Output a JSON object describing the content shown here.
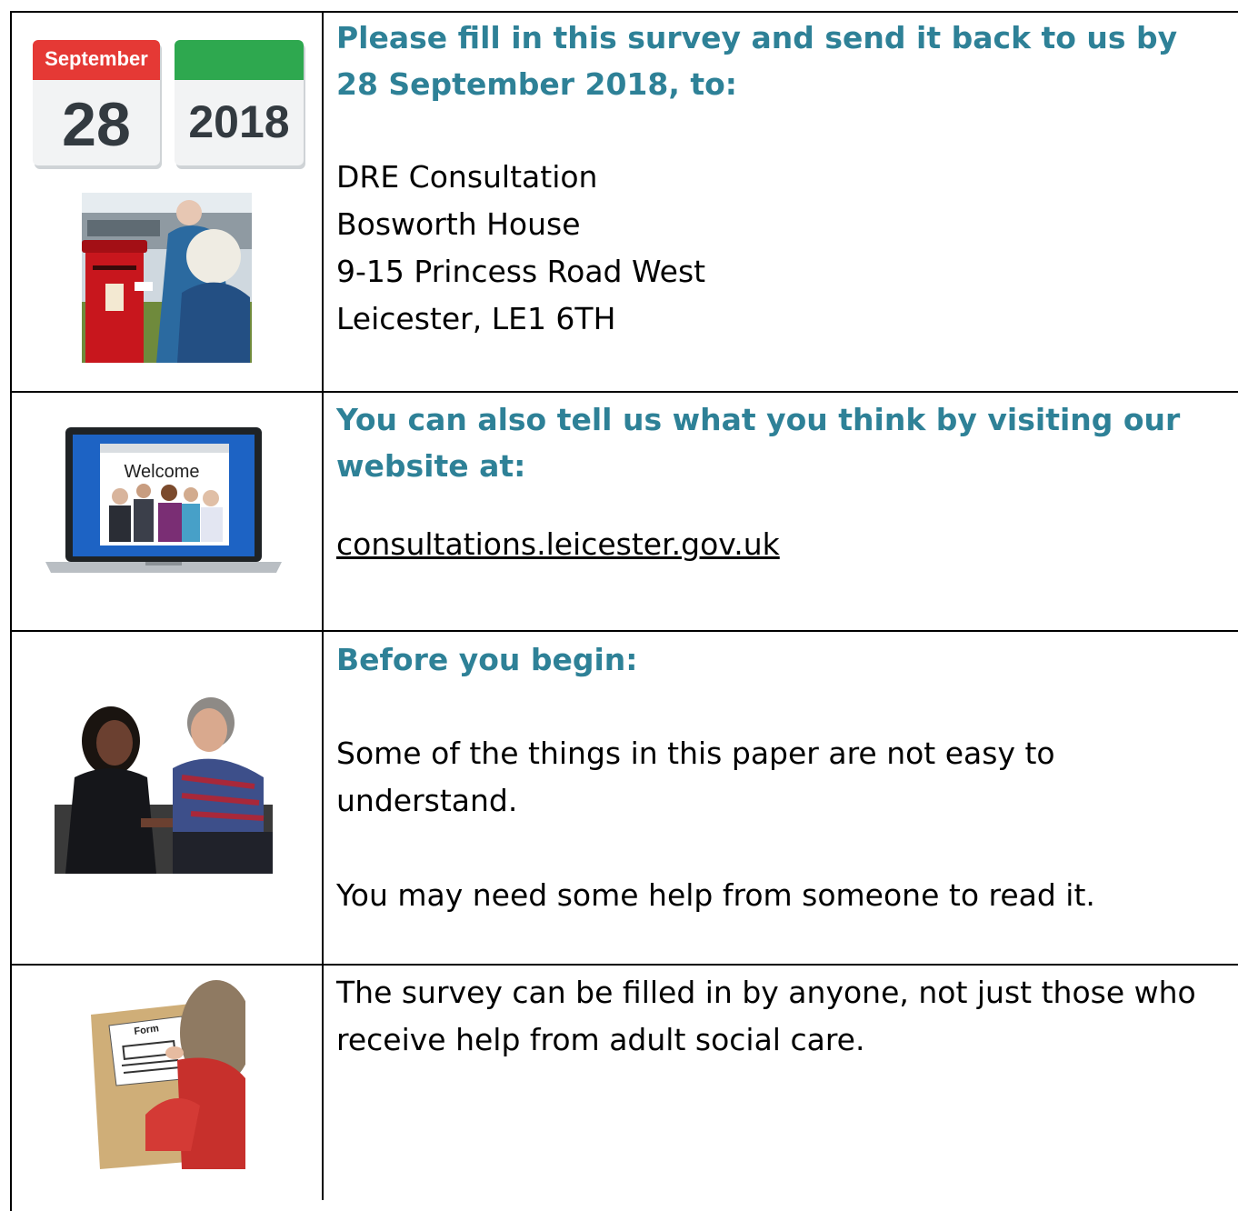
{
  "rows": [
    {
      "heading": [
        "Please fill in this survey and send it back to us by",
        "28 September 2018, to:"
      ],
      "address": [
        "DRE Consultation",
        "Bosworth House",
        "9-15 Princess Road West",
        "Leicester, LE1 6TH"
      ],
      "calendar": {
        "month": "September",
        "day": "28",
        "year": "2018",
        "month_color": "#e53935",
        "year_color": "#2ea84f"
      }
    },
    {
      "heading": [
        "You can also tell us what you think by visiting our",
        "website at:"
      ],
      "link": "consultations.leicester.gov.uk",
      "screen_text": "Welcome"
    },
    {
      "heading": [
        "Before you begin:"
      ],
      "paragraphs": [
        [
          "Some of the things in this paper are not easy to",
          "understand."
        ],
        [
          "You may need some help from someone to read it."
        ]
      ]
    },
    {
      "paragraphs": [
        [
          "The survey can be filled in by anyone, not just those who",
          "receive help from adult social care."
        ]
      ],
      "form_label": "Form"
    }
  ],
  "colors": {
    "heading": "#2e8197"
  }
}
